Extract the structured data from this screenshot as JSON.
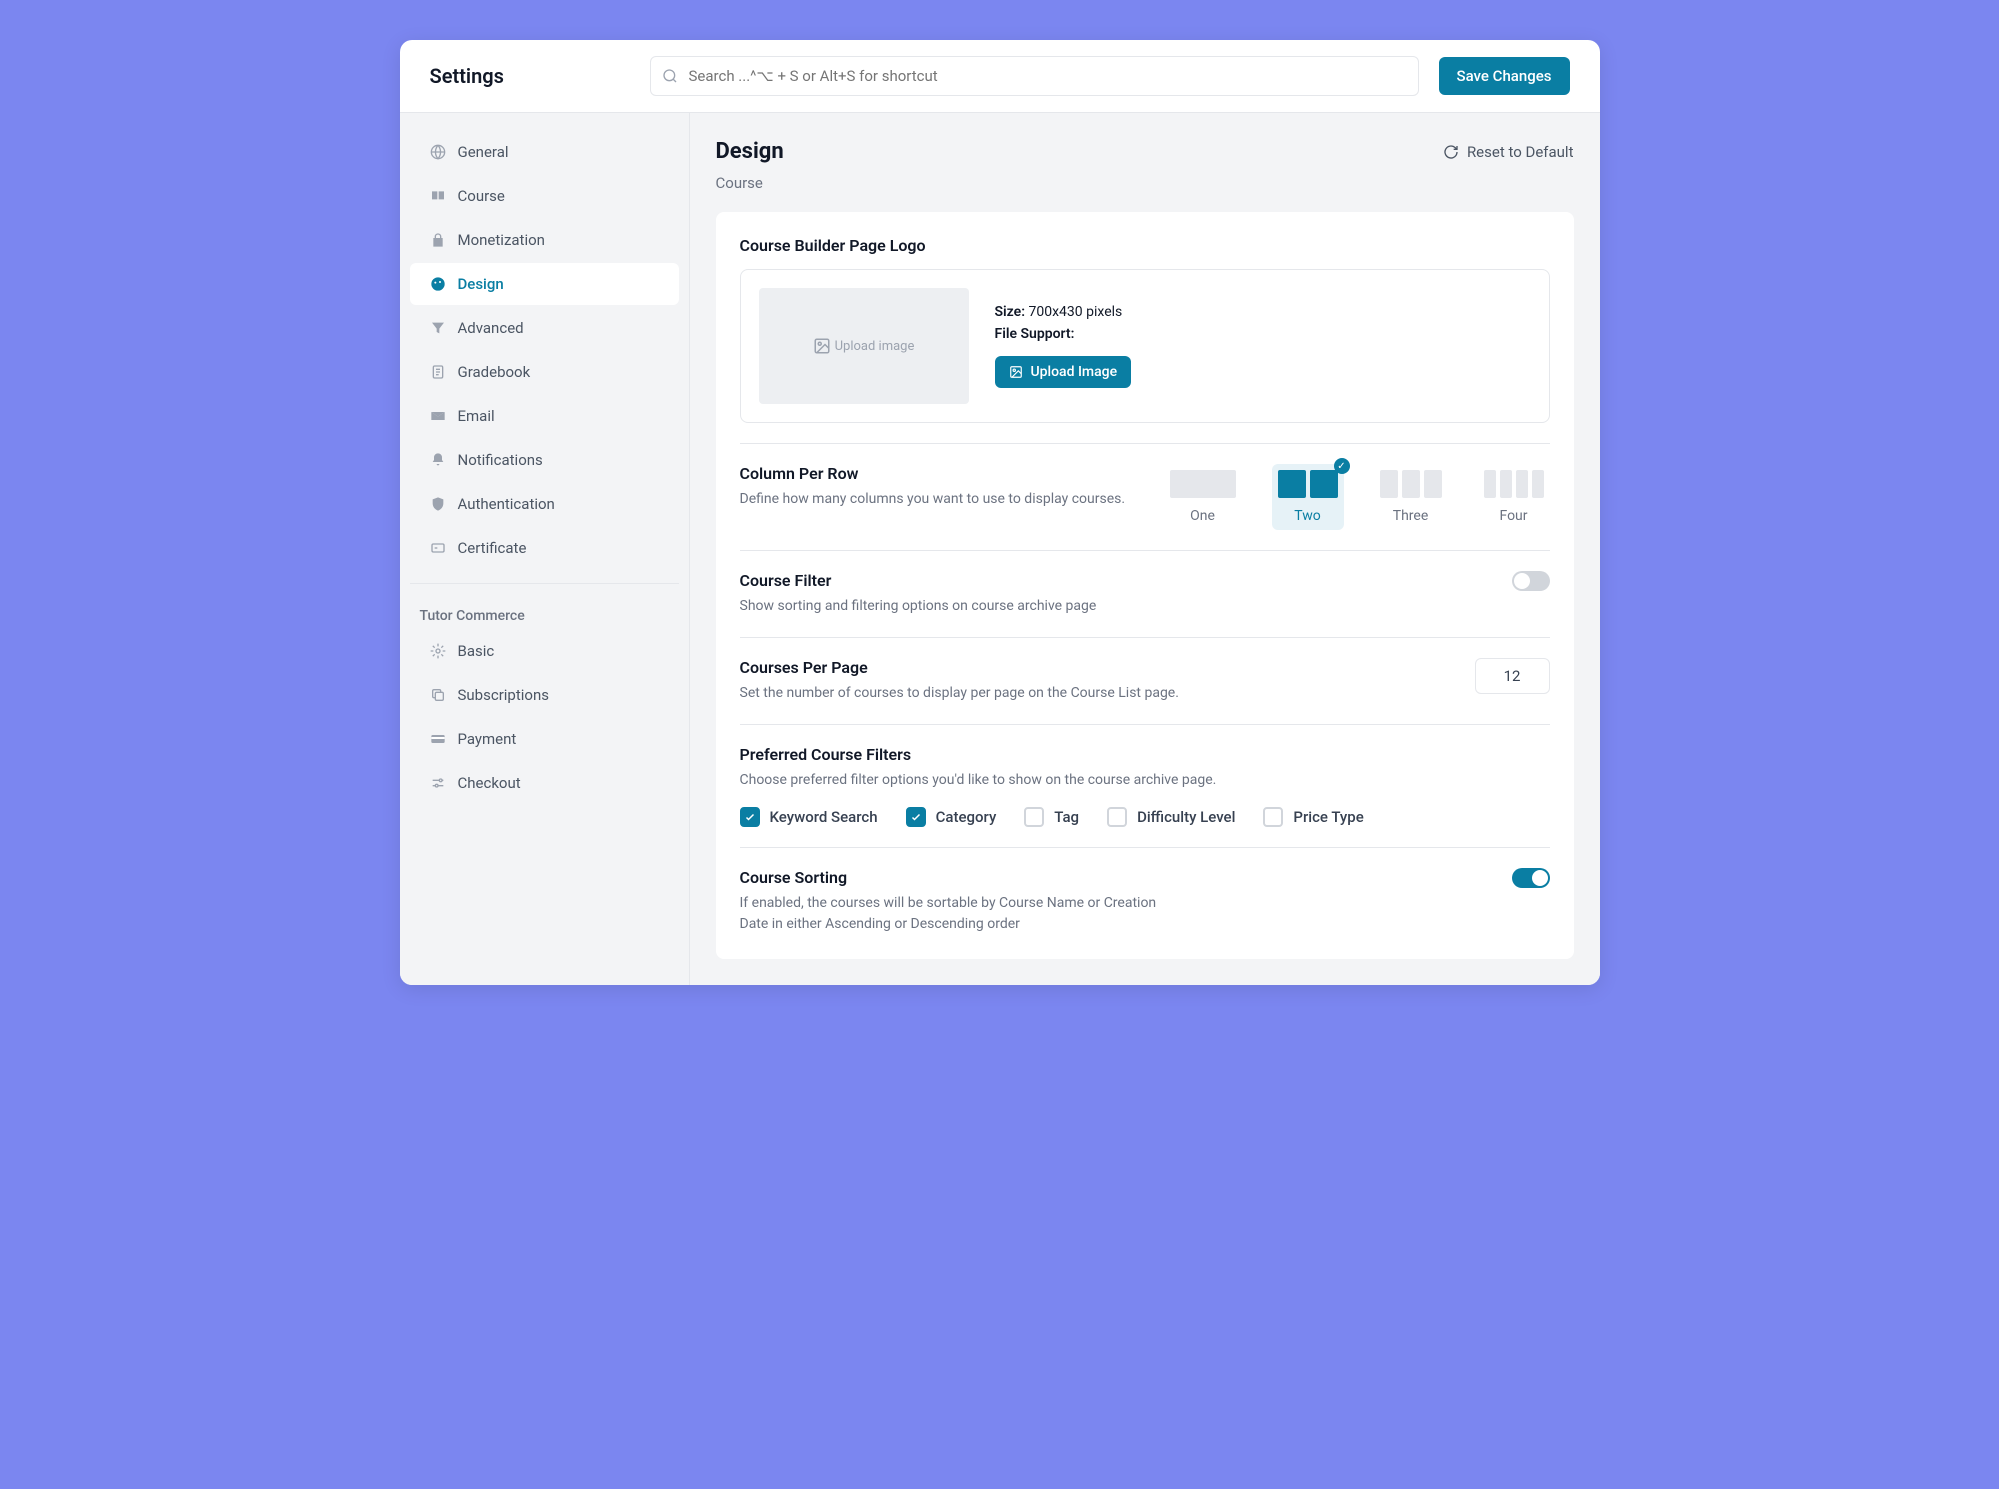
{
  "header": {
    "title": "Settings",
    "search_placeholder": "Search ...^⌥ + S or Alt+S for shortcut",
    "save_label": "Save Changes"
  },
  "sidebar": {
    "main_items": [
      {
        "label": "General",
        "icon": "globe"
      },
      {
        "label": "Course",
        "icon": "book"
      },
      {
        "label": "Monetization",
        "icon": "money"
      },
      {
        "label": "Design",
        "icon": "palette"
      },
      {
        "label": "Advanced",
        "icon": "filter"
      },
      {
        "label": "Gradebook",
        "icon": "clipboard"
      },
      {
        "label": "Email",
        "icon": "mail"
      },
      {
        "label": "Notifications",
        "icon": "bell"
      },
      {
        "label": "Authentication",
        "icon": "shield"
      },
      {
        "label": "Certificate",
        "icon": "card"
      }
    ],
    "section_label": "Tutor Commerce",
    "sub_items": [
      {
        "label": "Basic",
        "icon": "gear"
      },
      {
        "label": "Subscriptions",
        "icon": "copy"
      },
      {
        "label": "Payment",
        "icon": "credit"
      },
      {
        "label": "Checkout",
        "icon": "sliders"
      }
    ]
  },
  "page": {
    "title": "Design",
    "reset_label": "Reset to Default",
    "breadcrumb": "Course"
  },
  "logo": {
    "title": "Course Builder Page Logo",
    "drop_text": "Upload image",
    "size_label": "Size:",
    "size_value": "700x430 pixels",
    "support_label": "File Support:",
    "upload_btn": "Upload Image"
  },
  "columns": {
    "title": "Column Per Row",
    "desc": "Define how many columns you want to use to display courses.",
    "options": [
      "One",
      "Two",
      "Three",
      "Four"
    ],
    "selected": "Two"
  },
  "course_filter": {
    "title": "Course Filter",
    "desc": "Show sorting and filtering options on course archive page",
    "enabled": false
  },
  "per_page": {
    "title": "Courses Per Page",
    "desc": "Set the number of courses to display per page on the Course List page.",
    "value": "12"
  },
  "filters": {
    "title": "Preferred Course Filters",
    "desc": "Choose preferred filter options you'd like to show on the course archive page.",
    "options": [
      {
        "label": "Keyword Search",
        "checked": true
      },
      {
        "label": "Category",
        "checked": true
      },
      {
        "label": "Tag",
        "checked": false
      },
      {
        "label": "Difficulty Level",
        "checked": false
      },
      {
        "label": "Price Type",
        "checked": false
      }
    ]
  },
  "sorting": {
    "title": "Course Sorting",
    "desc": "If enabled, the courses will be sortable by Course Name or Creation Date in either Ascending or Descending order",
    "enabled": true
  }
}
